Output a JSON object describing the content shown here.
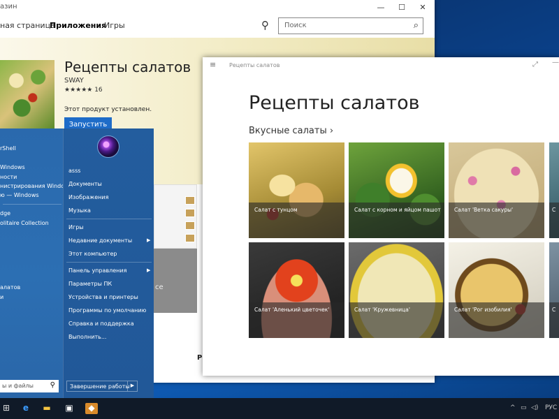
{
  "store": {
    "title_fragment": "азин",
    "tabs": [
      "ная страница",
      "Приложения",
      "Игры"
    ],
    "search_placeholder": "Поиск",
    "app_title": "Рецепты салатов",
    "publisher": "SWAY",
    "rating_text": "★★★★★ 16",
    "rating": 5,
    "installed_text": "Этот продукт установлен.",
    "launch_label": "Запустить",
    "screenshot_caption_fragment": "се",
    "bottom_fragment": "Р"
  },
  "start_menu": {
    "left_items": [
      "rShell",
      "Windows",
      "ности",
      "нистрирования Window",
      "ю — Windows",
      "dge",
      "olitaire Collection",
      "алатов",
      "и"
    ],
    "right_items": [
      {
        "label": "asss",
        "arrow": false
      },
      {
        "label": "Документы",
        "arrow": false
      },
      {
        "label": "Изображения",
        "arrow": false
      },
      {
        "label": "Музыка",
        "arrow": false
      },
      {
        "label": "Игры",
        "arrow": false
      },
      {
        "label": "Недавние документы",
        "arrow": true
      },
      {
        "label": "Этот компьютер",
        "arrow": false
      },
      {
        "label": "Панель управления",
        "arrow": true
      },
      {
        "label": "Параметры ПК",
        "arrow": false
      },
      {
        "label": "Устройства и принтеры",
        "arrow": false
      },
      {
        "label": "Программы по умолчанию",
        "arrow": false
      },
      {
        "label": "Справка и поддержка",
        "arrow": false
      },
      {
        "label": "Выполнить...",
        "arrow": false
      }
    ],
    "search_placeholder": "ы и файлы",
    "shutdown_label": "Завершение работы"
  },
  "recipes_app": {
    "window_title": "Рецепты салатов",
    "heading": "Рецепты салатов",
    "section_title": "Вкусные салаты",
    "tiles": [
      {
        "label": "Салат с тунцом",
        "color": "#c9b35a"
      },
      {
        "label": "Салат с корном и яйцом пашот",
        "color": "#4f8a2e"
      },
      {
        "label": "Салат 'Ветка сакуры'",
        "color": "#d9c99a"
      },
      {
        "label": "С",
        "color": "#3f6f7a"
      },
      {
        "label": "Салат 'Аленький цветочек'",
        "color": "#d4432a"
      },
      {
        "label": "Салат 'Кружевница'",
        "color": "#d8cf8a"
      },
      {
        "label": "Салат 'Рог изобилия'",
        "color": "#b7902e"
      },
      {
        "label": "С",
        "color": "#6c7e8e"
      }
    ]
  },
  "taskbar": {
    "language": "РУС"
  }
}
